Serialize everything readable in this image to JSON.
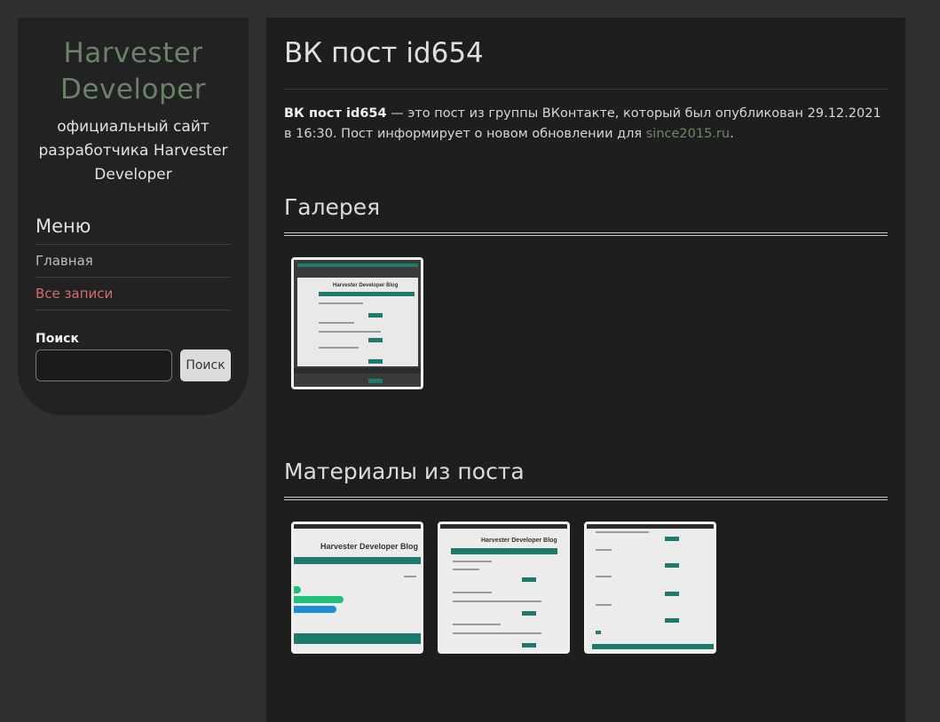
{
  "sidebar": {
    "site_title": "Harvester Developer",
    "site_description": "официальный сайт разработчика Harvester Developer",
    "menu_title": "Меню",
    "menu_items": [
      {
        "label": "Главная",
        "active": false
      },
      {
        "label": "Все записи",
        "active": true
      }
    ],
    "search_label": "Поиск",
    "search_value": "",
    "search_button": "Поиск"
  },
  "main": {
    "title": "ВК пост id654",
    "intro_bold": "ВК пост id654",
    "intro_text": " — это пост из группы ВКонтакте, который был опубликован 29.12.2021 в 16:30. Пост информирует о новом обновлении для ",
    "intro_link": "since2015.ru",
    "intro_end": ".",
    "gallery_title": "Галерея",
    "gallery_images": [
      {
        "caption": "Harvester Developer Blog",
        "icon": "screenshot-thumbnail"
      }
    ],
    "materials_title": "Материалы из поста",
    "material_images": [
      {
        "caption": "Harvester Developer Blog",
        "icon": "screenshot-thumbnail"
      },
      {
        "caption": "Harvester Developer Blog",
        "icon": "screenshot-thumbnail"
      },
      {
        "caption": "",
        "icon": "screenshot-thumbnail"
      }
    ]
  },
  "colors": {
    "page_bg": "#303030",
    "panel_bg": "#1e1e1e",
    "sidebar_bg": "#222222",
    "title_green": "#6a8268",
    "active_link": "#d86b6b",
    "accent_teal": "#1f7a6e"
  }
}
